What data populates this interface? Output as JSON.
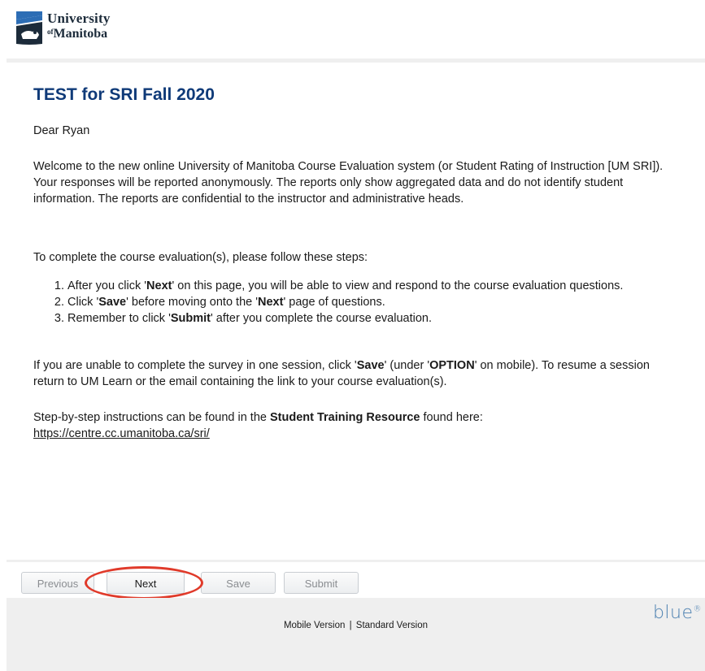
{
  "header": {
    "logo_line1": "University",
    "logo_of": "of",
    "logo_line2": "Manitoba"
  },
  "main": {
    "title": "TEST for SRI Fall 2020",
    "greeting": "Dear Ryan",
    "welcome": "Welcome to the new online University of Manitoba Course Evaluation system (or Student Rating of Instruction [UM SRI]). Your responses will be reported anonymously. The reports only show aggregated data and do not identify student information. The reports are confidential to the instructor and administrative heads.",
    "steps_intro": "To complete the course evaluation(s), please follow these steps:",
    "steps": [
      {
        "a": "After you click '",
        "b": "Next",
        "c": "' on this page, you will be able to view and respond to the course evaluation questions."
      },
      {
        "a": "Click '",
        "b": "Save",
        "c": "' before moving onto the '",
        "d": "Next",
        "e": "' page of questions."
      },
      {
        "a": "Remember to click '",
        "b": "Submit",
        "c": "' after you complete the course evaluation."
      }
    ],
    "unable": {
      "a": "If you are unable to complete the survey in one session, click '",
      "b": "Save",
      "c": "' (under '",
      "d": "OPTION",
      "e": "' on mobile). To resume a session return to UM Learn or the email containing the link to your course evaluation(s)."
    },
    "training": {
      "a": "Step-by-step instructions can be found in the ",
      "b": "Student Training Resource",
      "c": " found here:",
      "link": "https://centre.cc.umanitoba.ca/sri/"
    }
  },
  "buttons": {
    "previous": "Previous",
    "next": "Next",
    "save": "Save",
    "submit": "Submit"
  },
  "footer": {
    "mobile": "Mobile Version",
    "separator": "|",
    "standard": "Standard Version",
    "brand": "blue",
    "brand_mark": "®"
  },
  "colors": {
    "title": "#0f3a78",
    "highlight": "#e03a2a",
    "brand": "#4a7fb0"
  }
}
